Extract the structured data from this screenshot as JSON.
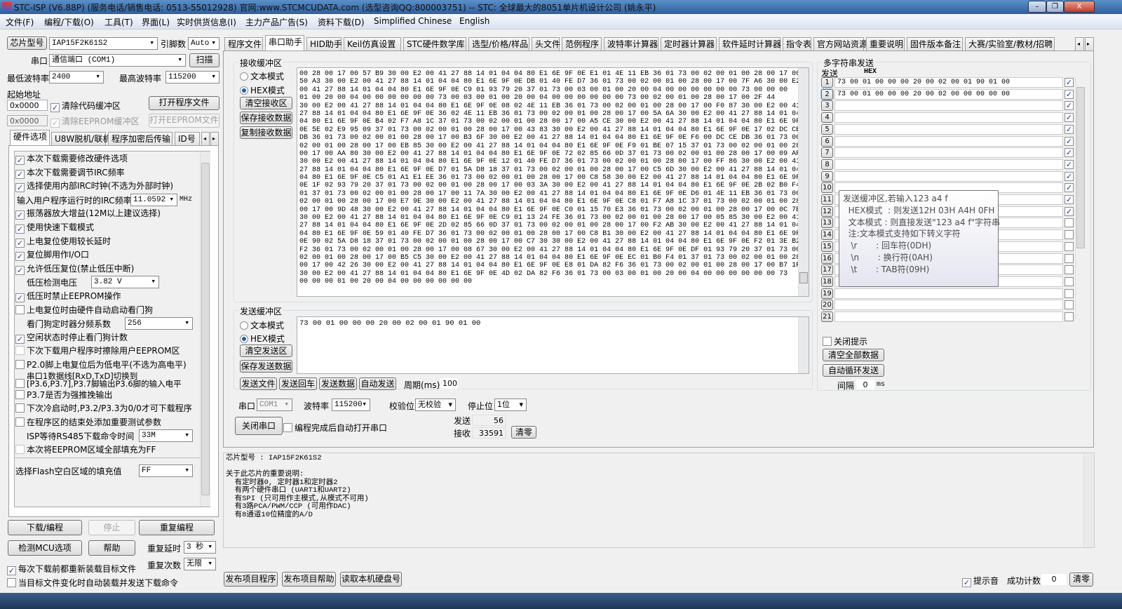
{
  "window": {
    "title": "STC-ISP (V6.88P) (服务电话/销售电话: 0513-55012928) 官网:www.STCMCUDATA.com  (选型咨询QQ:800003751) -- STC: 全球最大的8051单片机设计公司 (姚永平)",
    "minimize": "–",
    "maximize": "❐",
    "close": "X"
  },
  "menu": [
    "文件(F)",
    "编程/下载(O)",
    "工具(T)",
    "界面(L)",
    "实时供货信息(I)",
    "主力产品广告(S)",
    "资料下载(D)",
    "Simplified Chinese",
    "English"
  ],
  "left": {
    "chip_type_label": "芯片型号",
    "chip_type": "IAP15F2K61S2",
    "pins_label": "引脚数",
    "pins": "Auto",
    "port_label": "串口",
    "port": "通信端口 (COM1)",
    "scan": "扫描",
    "min_baud_label": "最低波特率",
    "min_baud": "2400",
    "max_baud_label": "最高波特率",
    "max_baud": "115200",
    "start_addr_label": "起始地址",
    "code_addr": "0x0000",
    "clear_code": "清除代码缓冲区",
    "open_program": "打开程序文件",
    "eeprom_addr": "0x0000",
    "clear_eeprom": "清除EEPROM缓冲区",
    "open_eeprom": "打开EEPROM文件",
    "tabs": [
      "硬件选项",
      "U8W脱机/联机",
      "程序加密后传输",
      "ID号"
    ],
    "options": [
      {
        "type": "check",
        "checked": true,
        "label": "本次下载需要修改硬件选项"
      },
      {
        "type": "check",
        "checked": true,
        "label": "本次下载需要调节IRC频率"
      },
      {
        "type": "check",
        "checked": true,
        "label": "选择使用内部IRC时钟(不选为外部时钟)"
      },
      {
        "type": "select",
        "label": "输入用户程序运行时的IRC频率",
        "value": "11.0592",
        "unit": "MHz"
      },
      {
        "type": "check",
        "checked": true,
        "label": "振荡器放大增益(12M以上建议选择)"
      },
      {
        "type": "check",
        "checked": true,
        "label": "使用快速下载模式"
      },
      {
        "type": "check",
        "checked": true,
        "label": "上电复位使用较长延时"
      },
      {
        "type": "check",
        "checked": true,
        "label": "复位脚用作I/O口"
      },
      {
        "type": "check",
        "checked": true,
        "label": "允许低压复位(禁止低压中断)"
      },
      {
        "type": "select",
        "label": "低压检测电压",
        "value": "3.82 V"
      },
      {
        "type": "check",
        "checked": true,
        "label": "低压时禁止EEPROM操作"
      },
      {
        "type": "check",
        "checked": false,
        "label": "上电复位时由硬件自动启动看门狗"
      },
      {
        "type": "select",
        "label": "看门狗定时器分频系数",
        "value": "256"
      },
      {
        "type": "check",
        "checked": true,
        "label": "空闲状态时停止看门狗计数"
      },
      {
        "type": "check",
        "checked": false,
        "disabled": true,
        "label": "下次下载用户程序时擦除用户EEPROM区"
      },
      {
        "type": "check",
        "checked": false,
        "label": "P2.0脚上电复位后为低电平(不选为高电平)"
      },
      {
        "type": "check2",
        "checked": false,
        "label": "串口1数据线[RxD,TxD]切换到",
        "label2": "[P3.6,P3.7],P3.7脚输出P3.6脚的输入电平"
      },
      {
        "type": "check",
        "checked": false,
        "label": "P3.7是否为强推挽输出"
      },
      {
        "type": "check",
        "checked": false,
        "label": "下次冷启动时,P3.2/P3.3为0/0才可下载程序"
      },
      {
        "type": "check",
        "checked": false,
        "label": "在程序区的结束处添加重要测试参数"
      },
      {
        "type": "select",
        "label": "ISP等待RS485下载命令时间",
        "value": "33M"
      },
      {
        "type": "check",
        "checked": false,
        "disabled": true,
        "label": "本次将EEPROM区域全部填充为FF"
      }
    ],
    "fill_label": "选择Flash空白区域的填充值",
    "fill_value": "FF",
    "download": "下载/编程",
    "stop": "停止",
    "repeat": "重复编程",
    "detect": "检测MCU选项",
    "help": "帮助",
    "repeat_delay_label": "重复延时",
    "repeat_delay": "3 秒",
    "repeat_count_label": "重复次数",
    "repeat_count": "无限",
    "reload": "每次下载前都重新装载目标文件",
    "auto_send": "当目标文件变化时自动装载并发送下载命令"
  },
  "tabs": [
    "程序文件",
    "串口助手",
    "HID助手",
    "Keil仿真设置",
    "STC硬件数学库",
    "选型/价格/样品",
    "头文件",
    "范例程序",
    "波特率计算器",
    "定时器计算器",
    "软件延时计算器",
    "指令表",
    "官方网站资源",
    "重要说明",
    "固件版本备注",
    "大赛/实验室/教材/招聘"
  ],
  "receive": {
    "title": "接收缓冲区",
    "text_mode": "文本模式",
    "hex_mode": "HEX模式",
    "clear": "清空接收区",
    "save": "保存接收数据",
    "copy": "复制接收数据",
    "lines": [
      "00 28 00 17 00 57 B9 30 00 E2 00 41 27 88 14 01 04 04 80 E1 6E 9F 0E E1 01 4E 11 EB 36 01 73 00 02 00 01 00 28 00 17 00",
      "50 A3 30 00 E2 00 41 27 88 14 01 04 04 80 E1 6E 9F 0E DB 01 40 FE D7 36 01 73 00 02 00 01 00 28 00 17 00 7F A6 30 00 E2",
      "00 41 27 88 14 01 04 04 80 E1 6E 9F 0E C9 01 93 79 20 37 01 73 00 03 00 01 00 20 00 04 00 00 00 00 00 00 73 00 00 00",
      "01 00 20 00 04 00 00 00 00 00 00 73 00 03 00 01 00 20 00 04 00 00 00 00 00 00 73 00 02 00 01 00 28 00 17 00 2F 44",
      "30 00 E2 00 41 27 88 14 01 04 04 80 E1 6E 9F 0E 08 02 4E 11 EB 36 01 73 00 02 00 01 00 28 00 17 00 F0 87 30 00 E2 00 41",
      "27 88 14 01 04 04 80 E1 6E 9F 0E 36 02 4E 11 EB 36 01 73 00 02 00 01 00 28 00 17 00 5A 6A 30 00 E2 00 41 27 88 14 01 04",
      "04 80 E1 6E 9F 0E B4 02 F7 A8 1C 37 01 73 00 02 00 01 00 28 00 17 00 A5 CE 30 00 E2 00 41 27 88 14 01 04 04 80 E1 6E 9F",
      "0E 5E 02 E9 95 09 37 01 73 00 02 00 01 00 28 00 17 00 43 83 30 00 E2 00 41 27 88 14 01 04 04 80 E1 6E 9F 0E 17 02 DC CE",
      "DB 36 01 73 00 02 00 01 00 28 00 17 00 B3 6F 30 00 E2 00 41 27 88 14 01 04 04 80 E1 6E 9F 0E F6 00 DC CE DB 36 01 73 00",
      "02 00 01 00 28 00 17 00 EB 85 30 00 E2 00 41 27 88 14 01 04 04 80 E1 6E 9F 0E F9 01 BE 07 15 37 01 73 00 02 00 01 00 28",
      "00 17 00 AA 80 30 00 E2 00 41 27 88 14 01 04 04 80 E1 6E 9F 0E 72 02 85 66 0D 37 01 73 00 02 00 01 00 28 00 17 00 09 AF",
      "30 00 E2 00 41 27 88 14 01 04 04 80 E1 6E 9F 0E 12 01 40 FE D7 36 01 73 00 02 00 01 00 28 00 17 00 FF 86 30 00 E2 00 41",
      "27 88 14 01 04 04 80 E1 6E 9F 0E D7 01 5A D8 18 37 01 73 00 02 00 01 00 28 00 17 00 C5 6D 30 00 E2 00 41 27 88 14 01 04",
      "04 80 E1 6E 9F 0E C5 01 A1 E1 EE 36 01 73 00 02 00 01 00 28 00 17 00 C8 58 30 00 E2 00 41 27 88 14 01 04 04 80 E1 6E 9F",
      "0E 1F 02 93 79 20 37 01 73 00 02 00 01 00 28 00 17 00 03 3A 30 00 E2 00 41 27 88 14 01 04 04 80 E1 6E 9F 0E 2B 02 B0 F4",
      "01 37 01 73 00 02 00 01 00 28 00 17 00 11 7A 30 00 E2 00 41 27 88 14 01 04 04 80 E1 6E 9F 0E D6 01 4E 11 EB 36 01 73 00",
      "02 00 01 00 28 00 17 00 E7 9E 30 00 E2 00 41 27 88 14 01 04 04 80 E1 6E 9F 0E C8 01 F7 A8 1C 37 01 73 00 02 00 01 00 28",
      "00 17 00 9D 48 30 00 E2 00 41 27 88 14 01 04 04 80 E1 6E 9F 0E C0 01 15 70 E3 36 01 73 00 02 00 01 00 28 00 17 00 0C 7E",
      "30 00 E2 00 41 27 88 14 01 04 04 80 E1 6E 9F 0E C9 01 13 24 FE 36 01 73 00 02 00 01 00 28 00 17 00 05 85 30 00 E2 00 41",
      "27 88 14 01 04 04 80 E1 6E 9F 0E 2D 02 85 66 0D 37 01 73 00 02 00 01 00 28 00 17 00 F2 AB 30 00 E2 00 41 27 88 14 01 04",
      "04 80 E1 6E 9F 0E 59 01 40 FE D7 36 01 73 00 02 00 01 00 28 00 17 00 C8 B1 30 00 E2 00 41 27 88 14 01 04 04 80 E1 6E 9F",
      "0E 90 02 5A D8 18 37 01 73 00 02 00 01 00 28 00 17 00 C7 30 30 00 E2 00 41 27 88 14 01 04 04 80 E1 6E 9F 0E F2 01 3E B2",
      "F2 36 01 73 00 02 00 01 00 28 00 17 00 08 67 30 00 E2 00 41 27 88 14 01 04 04 80 E1 6E 9F 0E DF 01 93 79 20 37 01 73 00",
      "02 00 01 00 28 00 17 00 B5 C5 30 00 E2 00 41 27 88 14 01 04 04 80 E1 6E 9F 0E EC 01 B0 F4 01 37 01 73 00 02 00 01 00 28",
      "00 17 00 42 26 30 00 E2 00 41 27 88 14 01 04 04 80 E1 6E 9F 0E E8 01 DA 82 F6 36 01 73 00 02 00 01 00 28 00 17 00 B7 1F",
      "30 00 E2 00 41 27 88 14 01 04 04 80 E1 6E 9F 0E 4D 02 DA 82 F6 36 01 73 00 03 00 01 00 20 00 04 00 00 00 00 00 00 73",
      "00 00 00 01 00 20 00 04 00 00 00 00 00 00"
    ]
  },
  "send": {
    "title": "发送缓冲区",
    "text_mode": "文本模式",
    "hex_mode": "HEX模式",
    "clear": "清空发送区",
    "save": "保存发送数据",
    "content": "73 00 01 00 00 00 20 00 02 00 01 90 01 00",
    "send_file": "发送文件",
    "send_enter": "发送回车",
    "send_data": "发送数据",
    "auto_send": "自动发送",
    "period_label": "周期(ms)",
    "period": "100"
  },
  "serial": {
    "port_label": "串口",
    "port": "COM1",
    "baud_label": "波特率",
    "baud": "115200",
    "parity_label": "校验位",
    "parity": "无校验",
    "stop_label": "停止位",
    "stop": "1位",
    "close": "关闭串口",
    "auto_open": "编程完成后自动打开串口",
    "tx_label": "发送",
    "tx": "56",
    "rx_label": "接收",
    "rx": "33591",
    "clear": "清零"
  },
  "multi": {
    "title": "多字符串发送",
    "send_label": "发送",
    "hex_label": "HEX",
    "rows": [
      {
        "n": "1",
        "value": "73 00 01 00 00 00 20 00 02 00 01 90 01 00",
        "hex": true
      },
      {
        "n": "2",
        "value": "73 00 01 00 00 00 20 00 02 00 00 00 00 00",
        "hex": true
      },
      {
        "n": "3",
        "value": "",
        "hex": true
      },
      {
        "n": "4",
        "value": "",
        "hex": true
      },
      {
        "n": "5",
        "value": "",
        "hex": true
      },
      {
        "n": "6",
        "value": "",
        "hex": true
      },
      {
        "n": "7",
        "value": "",
        "hex": true
      },
      {
        "n": "8",
        "value": "",
        "hex": true
      },
      {
        "n": "9",
        "value": "",
        "hex": true
      },
      {
        "n": "10",
        "value": "",
        "hex": true
      },
      {
        "n": "11",
        "value": "",
        "hex": true
      },
      {
        "n": "12",
        "value": "",
        "hex": true
      },
      {
        "n": "13",
        "value": "",
        "hex": false
      },
      {
        "n": "14",
        "value": "",
        "hex": false
      },
      {
        "n": "15",
        "value": "",
        "hex": false
      },
      {
        "n": "16",
        "value": "",
        "hex": false
      },
      {
        "n": "17",
        "value": "",
        "hex": false
      },
      {
        "n": "18",
        "value": "",
        "hex": false
      },
      {
        "n": "19",
        "value": "",
        "hex": false
      },
      {
        "n": "20",
        "value": "",
        "hex": false
      },
      {
        "n": "21",
        "value": "",
        "hex": false
      }
    ],
    "close_tip": "关闭提示",
    "clear_all": "清空全部数据",
    "auto_loop": "自动循环发送",
    "interval_label": "间隔",
    "interval": "0",
    "interval_unit": "ms"
  },
  "tooltip": [
    "发送缓冲区,若输入123 a4 f",
    "  HEX模式  : 则发送12H 03H A4H 0FH",
    "  文本模式 : 则直接发送\"123 a4 f\"字符串",
    "  注:文本模式支持如下转义字符",
    "   \\r       : 回车符(0DH)",
    "   \\n       : 换行符(0AH)",
    "   \\t       : TAB符(09H)"
  ],
  "info": [
    "芯片型号 : IAP15F2K61S2",
    "",
    "关于此芯片的重要说明:",
    "  有定时器0, 定时器1和定时器2",
    "  有两个硬件串口 (UART1和UART2)",
    "  有SPI (只可用作主模式,从模式不可用)",
    "  有3路PCA/PWM/CCP (可用作DAC)",
    "  有8通道10位精度的A/D"
  ],
  "bottom": {
    "publish_program": "发布项目程序",
    "publish_help": "发布项目帮助",
    "read_disk": "读取本机硬盘号",
    "beep": "提示音",
    "success_label": "成功计数",
    "success": "0",
    "clear": "清零"
  }
}
